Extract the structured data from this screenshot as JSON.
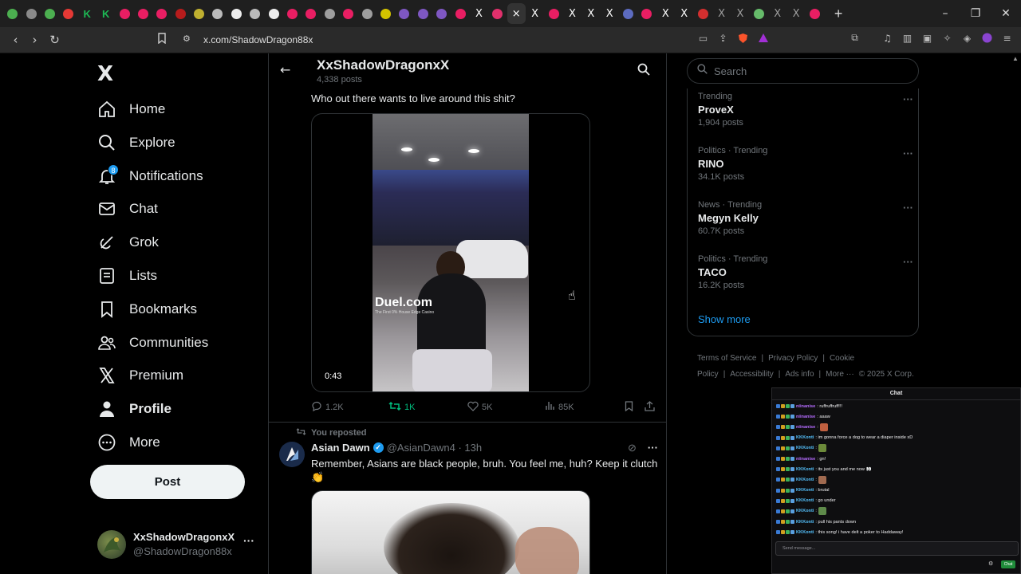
{
  "browser": {
    "tabs": [
      {
        "color": "#4caf50",
        "glyph": "o"
      },
      {
        "color": "#8a8a8a",
        "glyph": "o"
      },
      {
        "color": "#4caf50",
        "glyph": "o"
      },
      {
        "color": "#e53935",
        "glyph": "o"
      },
      {
        "color": "#1db954",
        "glyph": "K"
      },
      {
        "color": "#1db954",
        "glyph": "K"
      },
      {
        "color": "#e91e63",
        "glyph": "o"
      },
      {
        "color": "#e91e63",
        "glyph": "o"
      },
      {
        "color": "#e91e63",
        "glyph": "o"
      },
      {
        "color": "#b71c1c",
        "glyph": "o"
      },
      {
        "color": "#c0b030",
        "glyph": "o"
      },
      {
        "color": "#bbbbbb",
        "glyph": "o"
      },
      {
        "color": "#eeeeee",
        "glyph": "o"
      },
      {
        "color": "#bbbbbb",
        "glyph": "o"
      },
      {
        "color": "#eeeeee",
        "glyph": "o"
      },
      {
        "color": "#e91e63",
        "glyph": "o"
      },
      {
        "color": "#e91e63",
        "glyph": "o"
      },
      {
        "color": "#9e9e9e",
        "glyph": "o"
      },
      {
        "color": "#e91e63",
        "glyph": "o"
      },
      {
        "color": "#9e9e9e",
        "glyph": "o"
      },
      {
        "color": "#d4c400",
        "glyph": "o"
      },
      {
        "color": "#7e57c2",
        "glyph": "o"
      },
      {
        "color": "#7e57c2",
        "glyph": "o"
      },
      {
        "color": "#7e57c2",
        "glyph": "o"
      },
      {
        "color": "#e91e63",
        "glyph": "o"
      },
      {
        "color": "#ffffff",
        "glyph": "X"
      },
      {
        "color": "#e1306c",
        "glyph": "o"
      },
      {
        "color": "#ffffff",
        "glyph": "×",
        "active": true
      },
      {
        "color": "#ffffff",
        "glyph": "X"
      },
      {
        "color": "#e91e63",
        "glyph": "o"
      },
      {
        "color": "#ffffff",
        "glyph": "X"
      },
      {
        "color": "#ffffff",
        "glyph": "X"
      },
      {
        "color": "#ffffff",
        "glyph": "X"
      },
      {
        "color": "#5c6bc0",
        "glyph": "o"
      },
      {
        "color": "#e91e63",
        "glyph": "o"
      },
      {
        "color": "#ffffff",
        "glyph": "X"
      },
      {
        "color": "#ffffff",
        "glyph": "X"
      },
      {
        "color": "#d32f2f",
        "glyph": "o"
      },
      {
        "color": "#9e9e9e",
        "glyph": "X"
      },
      {
        "color": "#9e9e9e",
        "glyph": "X"
      },
      {
        "color": "#66bb6a",
        "glyph": "o"
      },
      {
        "color": "#9e9e9e",
        "glyph": "X"
      },
      {
        "color": "#9e9e9e",
        "glyph": "X"
      },
      {
        "color": "#e91e63",
        "glyph": "o"
      }
    ],
    "new_tab": "+",
    "url": "x.com/ShadowDragon88x",
    "window_controls": [
      "–",
      "❐",
      "✕"
    ]
  },
  "nav": {
    "logo": "X",
    "items": [
      {
        "label": "Home",
        "icon": "home-icon"
      },
      {
        "label": "Explore",
        "icon": "search-icon"
      },
      {
        "label": "Notifications",
        "icon": "bell-icon",
        "badge": "8"
      },
      {
        "label": "Chat",
        "icon": "mail-icon"
      },
      {
        "label": "Grok",
        "icon": "grok-icon"
      },
      {
        "label": "Lists",
        "icon": "list-icon"
      },
      {
        "label": "Bookmarks",
        "icon": "bookmark-icon"
      },
      {
        "label": "Communities",
        "icon": "people-icon"
      },
      {
        "label": "Premium",
        "icon": "x-icon"
      },
      {
        "label": "Profile",
        "icon": "person-icon",
        "bold": true
      },
      {
        "label": "More",
        "icon": "more-circle-icon"
      }
    ],
    "post_label": "Post",
    "account": {
      "name": "XxShadowDragonxX",
      "handle": "@ShadowDragon88x",
      "more": "···"
    }
  },
  "header": {
    "title": "XxShadowDragonxX",
    "posts": "4,338 posts"
  },
  "tweet": {
    "text": "Who out there wants to live around this shit?",
    "video_watermark": "Duel.com",
    "video_watermark_sub": "The First 0% House Edge Casino",
    "video_time": "0:43",
    "replies": "1.2K",
    "reposts": "1K",
    "likes": "5K",
    "views": "85K"
  },
  "retweet": {
    "note": "You reposted",
    "name": "Asian Dawn",
    "handle": "@AsianDawn4 · 13h",
    "text": "Remember, Asians are black people, bruh. You feel me, huh? Keep it clutch 👏"
  },
  "sidebar": {
    "search_placeholder": "Search",
    "trends": [
      {
        "context": "Trending",
        "name": "ProveX",
        "count": "1,904 posts"
      },
      {
        "context": "Politics · Trending",
        "name": "RINO",
        "count": "34.1K posts"
      },
      {
        "context": "News · Trending",
        "name": "Megyn Kelly",
        "count": "60.7K posts"
      },
      {
        "context": "Politics · Trending",
        "name": "TACO",
        "count": "16.2K posts"
      }
    ],
    "show_more": "Show more",
    "footer_links": [
      "Terms of Service",
      "|",
      "Privacy Policy",
      "|",
      "Cookie Policy",
      "|",
      "Accessibility",
      "|",
      "Ads info",
      "|",
      "More ···",
      "© 2025 X Corp."
    ]
  },
  "chat": {
    "title": "Chat",
    "messages": [
      {
        "user": "niinanise",
        "color": "#b56cff",
        "text": ": ruffruffruff!!!",
        "emote": ""
      },
      {
        "user": "niinanise",
        "color": "#b56cff",
        "text": ": aaaw",
        "emote": ""
      },
      {
        "user": "niinanise",
        "color": "#b56cff",
        "text": ":",
        "emote": "#c06040"
      },
      {
        "user": "KKKonti",
        "color": "#55c3ff",
        "text": ": im gonna force a dog to wear a diaper inside xD",
        "emote": ""
      },
      {
        "user": "KKKonti",
        "color": "#55c3ff",
        "text": ":",
        "emote": "#6c8a3a"
      },
      {
        "user": "niinanise",
        "color": "#b56cff",
        "text": ": gn!",
        "emote": ""
      },
      {
        "user": "KKKonti",
        "color": "#55c3ff",
        "text": ": its just you and me now 👀",
        "emote": ""
      },
      {
        "user": "KKKonti",
        "color": "#55c3ff",
        "text": ":",
        "emote": "#a06a50"
      },
      {
        "user": "KKKonti",
        "color": "#55c3ff",
        "text": ": brutal",
        "emote": ""
      },
      {
        "user": "KKKonti",
        "color": "#55c3ff",
        "text": ": go under",
        "emote": ""
      },
      {
        "user": "KKKonti",
        "color": "#55c3ff",
        "text": ":",
        "emote": "#5e8a4a"
      },
      {
        "user": "KKKonti",
        "color": "#55c3ff",
        "text": ": pull his pants down",
        "emote": ""
      },
      {
        "user": "KKKonti",
        "color": "#55c3ff",
        "text": ": this song! i have delt a poker to Haddaway!",
        "emote": ""
      }
    ],
    "input_placeholder": "Send message...",
    "send_label": "Chat"
  },
  "colors": {
    "accent": "#1d9bf0",
    "repost_green": "#00ba7c",
    "background": "#000000",
    "text": "#e7e9ea",
    "muted": "#71767b"
  }
}
